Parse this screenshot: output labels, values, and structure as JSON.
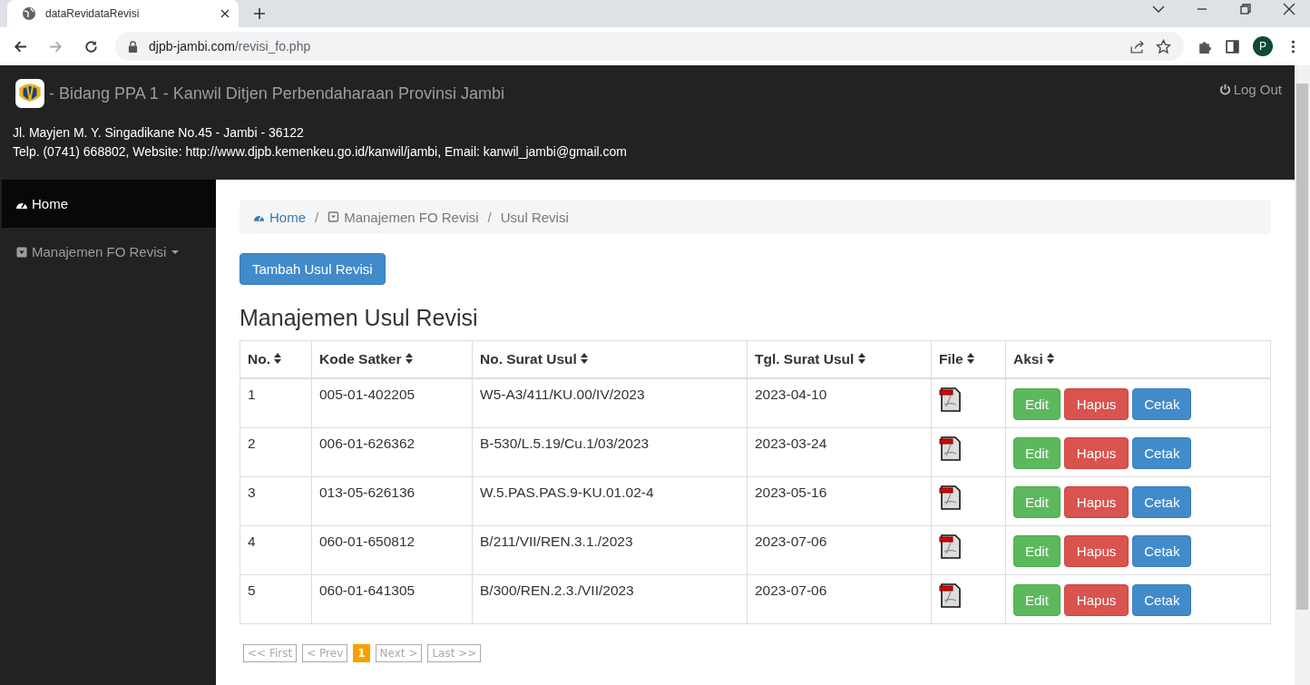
{
  "browser": {
    "tab_title": "dataRevidataRevisi",
    "url_host": "djpb-jambi.com",
    "url_path": "/revisi_fo.php",
    "profile_initial": "P"
  },
  "header": {
    "title": "- Bidang PPA 1 - Kanwil Ditjen Perbendaharaan Provinsi Jambi",
    "address": "Jl. Mayjen M. Y. Singadikane No.45 - Jambi - 36122",
    "contact": "Telp. (0741) 668802, Website: http://www.djpb.kemenkeu.go.id/kanwil/jambi, Email: kanwil_jambi@gmail.com",
    "logout": "Log Out"
  },
  "sidebar": {
    "items": [
      {
        "label": "Home",
        "kind": "home",
        "selected": true
      },
      {
        "label": "Manajemen FO Revisi",
        "kind": "dropdown",
        "selected": false
      }
    ]
  },
  "breadcrumb_separator": "/",
  "breadcrumb": [
    {
      "label": "Home",
      "kind": "home"
    },
    {
      "label": "Manajemen FO Revisi",
      "kind": "menu"
    },
    {
      "label": "Usul Revisi",
      "kind": "current"
    }
  ],
  "add_button": "Tambah Usul Revisi",
  "heading": "Manajemen Usul Revisi",
  "table": {
    "columns": [
      "No.",
      "Kode Satker",
      "No. Surat Usul",
      "Tgl. Surat Usul",
      "File",
      "Aksi"
    ],
    "rows": [
      {
        "cells": [
          "1",
          "005-01-402205",
          "W5-A3/411/KU.00/IV/2023",
          "2023-04-10"
        ],
        "actions": [
          {
            "label": "Edit",
            "kind": "edit"
          },
          {
            "label": "Hapus",
            "kind": "delete"
          },
          {
            "label": "Cetak",
            "kind": "print"
          }
        ]
      },
      {
        "cells": [
          "2",
          "006-01-626362",
          "B-530/L.5.19/Cu.1/03/2023",
          "2023-03-24"
        ],
        "actions": [
          {
            "label": "Edit",
            "kind": "edit"
          },
          {
            "label": "Hapus",
            "kind": "delete"
          },
          {
            "label": "Cetak",
            "kind": "print"
          }
        ]
      },
      {
        "cells": [
          "3",
          "013-05-626136",
          "W.5.PAS.PAS.9-KU.01.02-4",
          "2023-05-16"
        ],
        "actions": [
          {
            "label": "Edit",
            "kind": "edit"
          },
          {
            "label": "Hapus",
            "kind": "delete"
          },
          {
            "label": "Cetak",
            "kind": "print"
          }
        ]
      },
      {
        "cells": [
          "4",
          "060-01-650812",
          "B/211/VII/REN.3.1./2023",
          "2023-07-06"
        ],
        "actions": [
          {
            "label": "Edit",
            "kind": "edit"
          },
          {
            "label": "Hapus",
            "kind": "delete"
          },
          {
            "label": "Cetak",
            "kind": "print"
          }
        ]
      },
      {
        "cells": [
          "5",
          "060-01-641305",
          "B/300/REN.2.3./VII/2023",
          "2023-07-06"
        ],
        "actions": [
          {
            "label": "Edit",
            "kind": "edit"
          },
          {
            "label": "Hapus",
            "kind": "delete"
          },
          {
            "label": "Cetak",
            "kind": "print"
          }
        ]
      }
    ]
  },
  "pagination": [
    {
      "label": "<< First",
      "selected": false
    },
    {
      "label": "< Prev",
      "selected": false
    },
    {
      "label": "1",
      "selected": true
    },
    {
      "label": "Next >",
      "selected": false
    },
    {
      "label": "Last >>",
      "selected": false
    }
  ]
}
